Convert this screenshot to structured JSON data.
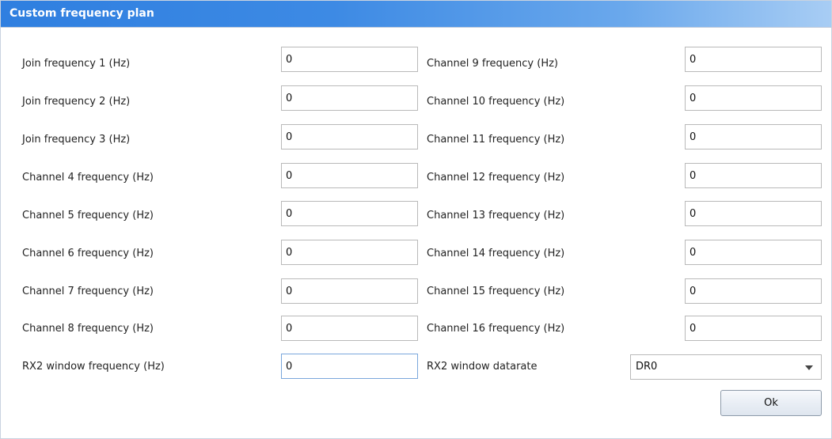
{
  "window": {
    "title": "Custom frequency plan"
  },
  "left_fields": [
    {
      "label": "Join frequency 1 (Hz)",
      "value": "0"
    },
    {
      "label": "Join frequency 2 (Hz)",
      "value": "0"
    },
    {
      "label": "Join frequency 3 (Hz)",
      "value": "0"
    },
    {
      "label": "Channel 4 frequency (Hz)",
      "value": "0"
    },
    {
      "label": "Channel 5 frequency (Hz)",
      "value": "0"
    },
    {
      "label": "Channel 6 frequency (Hz)",
      "value": "0"
    },
    {
      "label": "Channel 7 frequency (Hz)",
      "value": "0"
    },
    {
      "label": "Channel 8 frequency (Hz)",
      "value": "0"
    },
    {
      "label": "RX2 window frequency (Hz)",
      "value": "0"
    }
  ],
  "right_fields": [
    {
      "label": "Channel 9 frequency (Hz)",
      "value": "0"
    },
    {
      "label": "Channel 10 frequency (Hz)",
      "value": "0"
    },
    {
      "label": "Channel 11 frequency (Hz)",
      "value": "0"
    },
    {
      "label": "Channel 12 frequency (Hz)",
      "value": "0"
    },
    {
      "label": "Channel 13 frequency (Hz)",
      "value": "0"
    },
    {
      "label": "Channel 14 frequency (Hz)",
      "value": "0"
    },
    {
      "label": "Channel 15 frequency (Hz)",
      "value": "0"
    },
    {
      "label": "Channel 16 frequency (Hz)",
      "value": "0"
    }
  ],
  "datarate": {
    "label": "RX2 window datarate",
    "value": "DR0"
  },
  "ok_label": "Ok"
}
